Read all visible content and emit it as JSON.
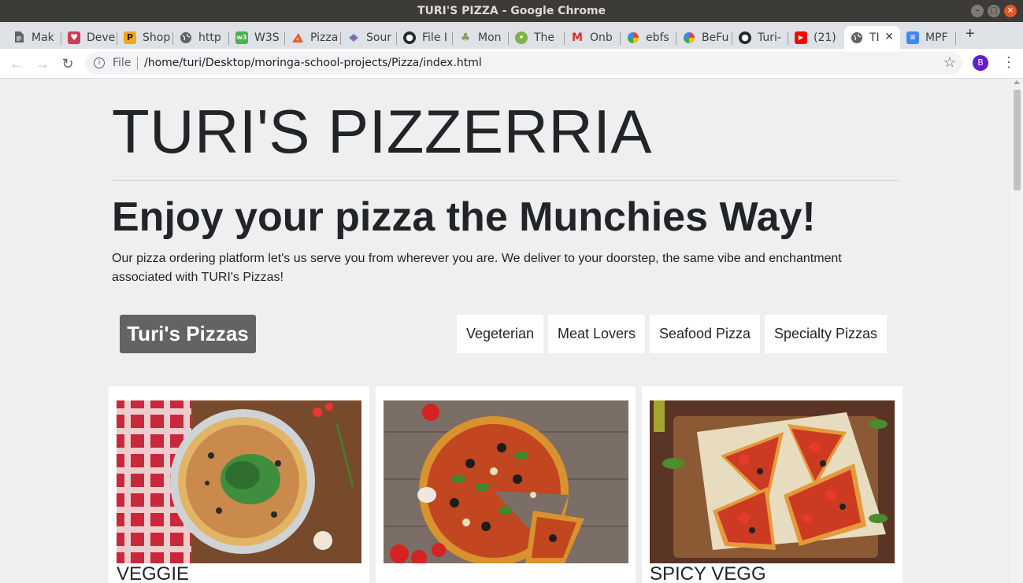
{
  "window": {
    "title": "TURI'S PIZZA - Google Chrome"
  },
  "tabs": [
    {
      "label": "Mak",
      "icon": "document-icon",
      "color": "#5f6368"
    },
    {
      "label": "Deve",
      "icon": "dev-heart-icon",
      "color": "#d23a57"
    },
    {
      "label": "Shop",
      "icon": "p-letter-icon",
      "color": "#f3a712"
    },
    {
      "label": "http",
      "icon": "globe-icon",
      "color": "#5f6368"
    },
    {
      "label": "W3S",
      "icon": "w3-icon",
      "color": "#4caf50"
    },
    {
      "label": "Pizza",
      "icon": "pizza-icon",
      "color": "#e65c2f"
    },
    {
      "label": "Sour",
      "icon": "sourcegraph-icon",
      "color": "#4285f4"
    },
    {
      "label": "File I",
      "icon": "github-icon",
      "color": "#24292e"
    },
    {
      "label": "Mon",
      "icon": "tree-icon",
      "color": "#8a9a5b"
    },
    {
      "label": "The",
      "icon": "bulb-icon",
      "color": "#7cb342"
    },
    {
      "label": "Onb",
      "icon": "gmail-icon",
      "color": "#d93025"
    },
    {
      "label": "ebfs",
      "icon": "pinwheel-icon",
      "color": "#34a853"
    },
    {
      "label": "BeFu",
      "icon": "pinwheel-icon",
      "color": "#fbbc05"
    },
    {
      "label": "Turi-",
      "icon": "github-icon",
      "color": "#24292e"
    },
    {
      "label": "(21)",
      "icon": "youtube-icon",
      "color": "#ff0000"
    },
    {
      "label": "TI",
      "icon": "globe-icon",
      "color": "#5f6368",
      "active": true
    },
    {
      "label": "MPF",
      "icon": "docs-icon",
      "color": "#4285f4"
    }
  ],
  "address_bar": {
    "scheme_label": "File",
    "url": "/home/turi/Desktop/moringa-school-projects/Pizza/index.html"
  },
  "profile": {
    "initial": "B"
  },
  "page": {
    "site_title": "TURI'S PIZZERRIA",
    "tagline": "Enjoy your pizza the Munchies Way!",
    "intro": "Our pizza ordering platform let's us serve you from wherever you are. We deliver to your doorstep, the same vibe and enchantment associated with TURI's Pizzas!",
    "brand_button": "Turi's Pizzas",
    "nav_buttons": [
      "Vegeterian",
      "Meat Lovers",
      "Seafood Pizza",
      "Specialty Pizzas"
    ],
    "cards": [
      {
        "name": "VEGGIE"
      },
      {
        "name": ""
      },
      {
        "name": "SPICY VEGG"
      }
    ]
  }
}
